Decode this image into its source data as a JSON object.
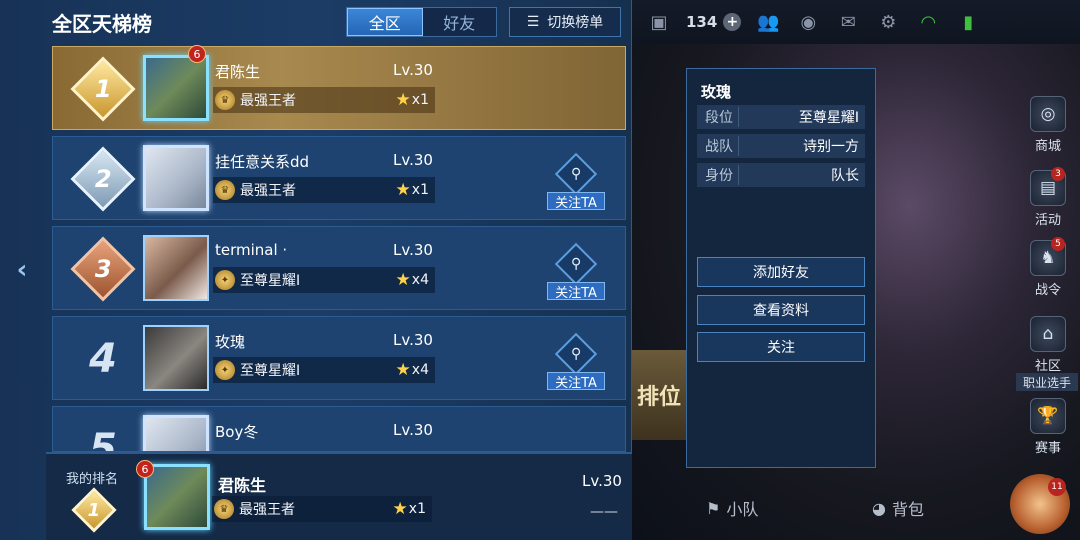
{
  "header": {
    "title": "全区天梯榜",
    "tab_all": "全区",
    "tab_friends": "好友",
    "switch_label": "切换榜单"
  },
  "topbar": {
    "coins": "134"
  },
  "rows": [
    {
      "rank": "1",
      "name": "君陈生",
      "level": "Lv.30",
      "tier": "最强王者",
      "stars": "x1",
      "notif": "6"
    },
    {
      "rank": "2",
      "name": "挂任意关系dd",
      "level": "Lv.30",
      "tier": "最强王者",
      "stars": "x1",
      "follow": "关注TA"
    },
    {
      "rank": "3",
      "name": "terminal ·",
      "level": "Lv.30",
      "tier": "至尊星耀Ⅰ",
      "stars": "x4",
      "follow": "关注TA"
    },
    {
      "rank": "4",
      "name": "玫瑰",
      "level": "Lv.30",
      "tier": "至尊星耀Ⅰ",
      "stars": "x4",
      "follow": "关注TA"
    },
    {
      "rank": "5",
      "name": "Boy冬",
      "level": "Lv.30"
    }
  ],
  "my_rank": {
    "label": "我的排名",
    "rank": "1",
    "name": "君陈生",
    "level": "Lv.30",
    "tier": "最强王者",
    "stars": "x1",
    "notif": "6",
    "extra": "——"
  },
  "profile_card": {
    "title": "玫瑰",
    "fields": [
      {
        "key": "段位",
        "value": "至尊星耀Ⅰ"
      },
      {
        "key": "战队",
        "value": "诗别一方"
      },
      {
        "key": "身份",
        "value": "队长"
      }
    ],
    "add_friend": "添加好友",
    "view_profile": "查看资料",
    "follow": "关注"
  },
  "sidebar": {
    "shop": "商城",
    "activity": "活动",
    "activity_badge": "3",
    "battlepass": "战令",
    "battlepass_badge": "5",
    "community": "社区",
    "pro_player": "职业选手",
    "events": "赛事",
    "hero_badge": "11"
  },
  "bottom": {
    "team": "小队",
    "bag": "背包"
  },
  "rank_button": "排位"
}
